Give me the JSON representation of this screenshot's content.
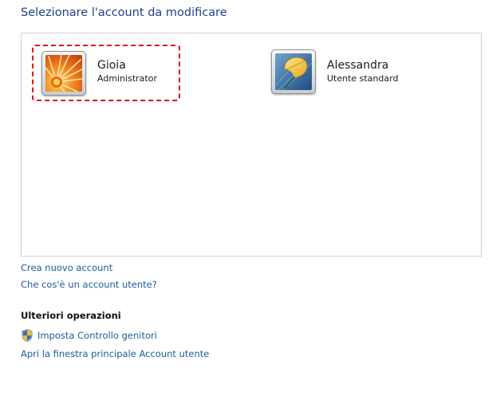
{
  "page": {
    "title": "Selezionare l'account da modificare"
  },
  "accounts": [
    {
      "name": "Gioia",
      "role": "Administrator",
      "avatar": "flower-icon",
      "selected": true
    },
    {
      "name": "Alessandra",
      "role": "Utente standard",
      "avatar": "leaf-icon",
      "selected": false
    }
  ],
  "links": {
    "create_account": "Crea nuovo account",
    "what_is_account": "Che cos'è un account utente?"
  },
  "more_operations": {
    "heading": "Ulteriori operazioni",
    "parental_controls": "Imposta Controllo genitori",
    "parental_controls_icon": "uac-shield-icon",
    "open_user_accounts": "Apri la finestra principale Account utente"
  },
  "colors": {
    "title": "#1e3f8f",
    "link": "#1e5b9e",
    "selection_border": "#e01010",
    "panel_border": "#cfd3d8"
  }
}
